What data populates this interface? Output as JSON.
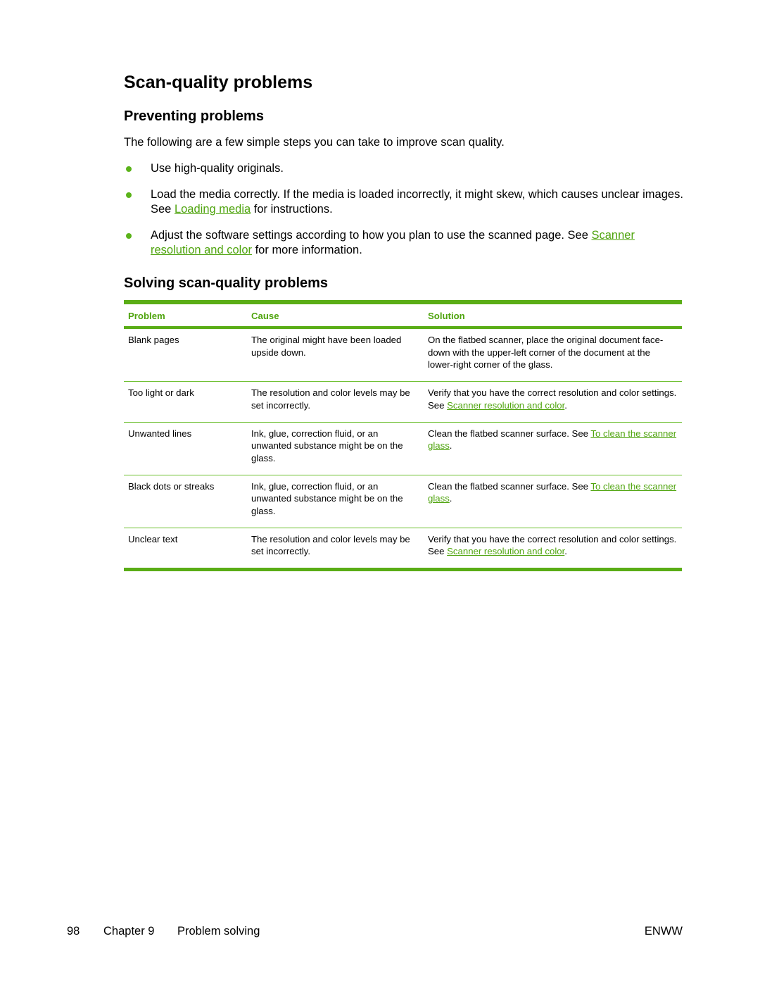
{
  "page_title": "Scan-quality problems",
  "preventing": {
    "heading": "Preventing problems",
    "intro": "The following are a few simple steps you can take to improve scan quality.",
    "bullets": [
      {
        "text_before": "Use high-quality originals.",
        "link": "",
        "text_after": ""
      },
      {
        "text_before": "Load the media correctly. If the media is loaded incorrectly, it might skew, which causes unclear images. See ",
        "link": "Loading media",
        "text_after": " for instructions."
      },
      {
        "text_before": "Adjust the software settings according to how you plan to use the scanned page. See ",
        "link": "Scanner resolution and color",
        "text_after": " for more information."
      }
    ]
  },
  "solving": {
    "heading": "Solving scan-quality problems",
    "columns": [
      "Problem",
      "Cause",
      "Solution"
    ],
    "rows": [
      {
        "problem": "Blank pages",
        "cause": "The original might have been loaded upside down.",
        "solution_before": "On the flatbed scanner, place the original document face-down with the upper-left corner of the document at the lower-right corner of the glass.",
        "solution_link": "",
        "solution_after": ""
      },
      {
        "problem": "Too light or dark",
        "cause": "The resolution and color levels may be set incorrectly.",
        "solution_before": "Verify that you have the correct resolution and color settings. See ",
        "solution_link": "Scanner resolution and color",
        "solution_after": "."
      },
      {
        "problem": "Unwanted lines",
        "cause": "Ink, glue, correction fluid, or an unwanted substance might be on the glass.",
        "solution_before": "Clean the flatbed scanner surface. See ",
        "solution_link": "To clean the scanner glass",
        "solution_after": "."
      },
      {
        "problem": "Black dots or streaks",
        "cause": "Ink, glue, correction fluid, or an unwanted substance might be on the glass.",
        "solution_before": "Clean the flatbed scanner surface. See ",
        "solution_link": "To clean the scanner glass",
        "solution_after": "."
      },
      {
        "problem": "Unclear text",
        "cause": "The resolution and color levels may be set incorrectly.",
        "solution_before": "Verify that you have the correct resolution and color settings. See ",
        "solution_link": "Scanner resolution and color",
        "solution_after": "."
      }
    ]
  },
  "footer": {
    "page_number": "98",
    "chapter": "Chapter 9",
    "section": "Problem solving",
    "locale": "ENWW"
  },
  "colors": {
    "accent_green": "#5aad16",
    "link_green": "#4fa40e"
  }
}
